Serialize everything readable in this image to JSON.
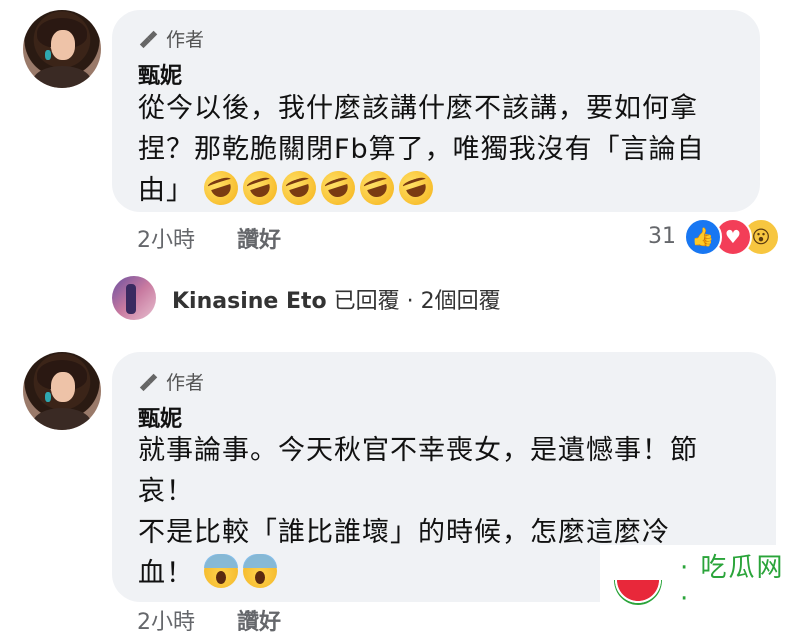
{
  "comments": [
    {
      "badge": "作者",
      "name": "甄妮",
      "lines": [
        "從今以後，我什麼該講什麼不該講，要如何拿",
        "捏？那乾脆關閉Fb算了，唯獨我沒有「言論自",
        "由」"
      ],
      "emoji": [
        "rolling-laugh",
        "rolling-laugh",
        "rolling-laugh",
        "rolling-laugh",
        "rolling-laugh",
        "rolling-laugh"
      ],
      "time": "2小時",
      "like": "讚好",
      "reaction_count": "31"
    },
    {
      "badge": "作者",
      "name": "甄妮",
      "lines": [
        "就事論事。今天秋官不幸喪女，是遺憾事！節",
        "哀！",
        "不是比較「誰比誰壞」的時候，怎麼這麼冷",
        "血！"
      ],
      "emoji": [
        "scream",
        "scream"
      ],
      "time": "2小時",
      "like": "讚好"
    }
  ],
  "reply": {
    "name": "Kinasine Eto",
    "text": " 已回覆 · 2個回覆"
  },
  "watermark": {
    "text": "· 吃瓜网 ·"
  }
}
